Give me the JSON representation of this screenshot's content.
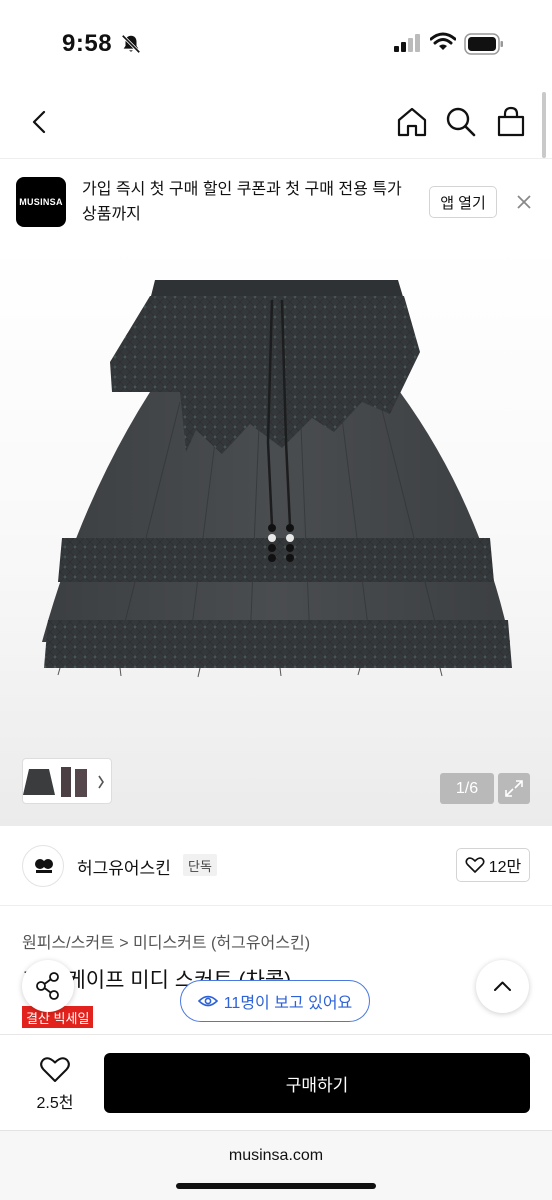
{
  "status_bar": {
    "time": "9:58",
    "icons": [
      "bell-slash-icon",
      "cellular-signal-icon",
      "wifi-icon",
      "battery-icon"
    ]
  },
  "nav": {
    "icons": [
      "back-chevron-icon",
      "home-icon",
      "search-icon",
      "shopping-bag-icon"
    ]
  },
  "banner": {
    "logo_text": "MUSINSA",
    "message": "가입 즉시 첫 구매 할인 쿠폰과 첫 구매 전용 특가 상품까지",
    "open_label": "앱 열기"
  },
  "gallery": {
    "page_counter": "1/6",
    "current_page": 1,
    "total_pages": 6
  },
  "brand": {
    "name": "허그유어스킨",
    "badge": "단독",
    "likes": "12만"
  },
  "product": {
    "category_path": "원피스/스커트 > 미디스커트 (허그유어스킨)",
    "title": "프릴 케이프 미디 스커트 (차콜)",
    "sale_badge": "결산 빅세일",
    "viewers": "11명이 보고 있어요"
  },
  "action_bar": {
    "wish_count": "2.5천",
    "buy_label": "구매하기"
  },
  "browser": {
    "url": "musinsa.com"
  },
  "colors": {
    "accent_blue": "#2d62d8",
    "sale_red": "#e2221c",
    "buy_button": "#000000",
    "skirt_charcoal": "#3a3c3e"
  }
}
